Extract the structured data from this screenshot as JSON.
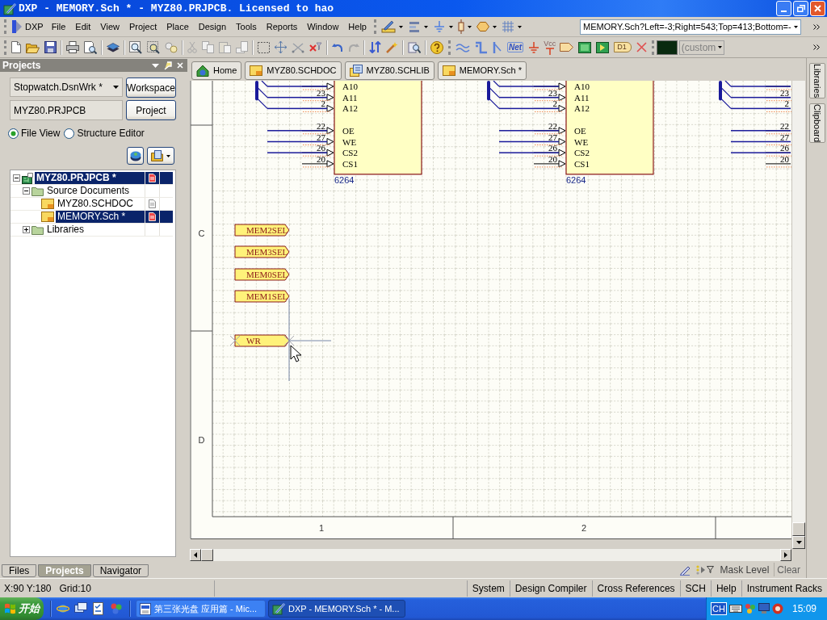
{
  "window": {
    "title": "DXP - MEMORY.Sch * - MYZ80.PRJPCB. Licensed to hao"
  },
  "app_menu": "DXP",
  "menu": [
    "File",
    "Edit",
    "View",
    "Project",
    "Place",
    "Design",
    "Tools",
    "Reports",
    "Window",
    "Help"
  ],
  "address": {
    "value": "MEMORY.Sch?Left=-3;Right=543;Top=413;Bottom=-"
  },
  "wiring_toolbar": {
    "net_label": "Net",
    "power_port": "Vcc",
    "part": "D1"
  },
  "color_combo": {
    "value": "(custom"
  },
  "projects_panel": {
    "title": "Projects",
    "workspace": "Stopwatch.DsnWrk *",
    "workspace_button": "Workspace",
    "project": "MYZ80.PRJPCB",
    "project_button": "Project",
    "views": [
      {
        "label": "File View",
        "selected": true
      },
      {
        "label": "Structure Editor",
        "selected": false
      }
    ],
    "tree": [
      {
        "kind": "project",
        "label": "MYZ80.PRJPCB *",
        "selected": true,
        "modified": true,
        "expanded": true,
        "children": [
          {
            "kind": "folder",
            "label": "Source Documents",
            "selected": false,
            "expanded": true,
            "children": [
              {
                "kind": "document",
                "label": "MYZ80.SCHDOC",
                "selected": false,
                "modified": false
              },
              {
                "kind": "document",
                "label": "MEMORY.Sch *",
                "selected": true,
                "modified": true
              }
            ]
          },
          {
            "kind": "folder",
            "label": "Libraries",
            "selected": false,
            "expanded": false
          }
        ]
      }
    ]
  },
  "panel_tabs": [
    {
      "label": "Files",
      "selected": false
    },
    {
      "label": "Projects",
      "selected": true
    },
    {
      "label": "Navigator",
      "selected": false
    }
  ],
  "document_tabs": [
    {
      "kind": "home",
      "label": "Home"
    },
    {
      "kind": "schematic",
      "label": "MYZ80.SCHDOC"
    },
    {
      "kind": "library",
      "label": "MYZ80.SCHLIB"
    },
    {
      "kind": "schematic",
      "label": "MEMORY.Sch *"
    }
  ],
  "side_tabs": [
    "Libraries",
    "Clipboard"
  ],
  "schematic": {
    "row_zones": [
      "C",
      "D"
    ],
    "column_zones": [
      "1",
      "2"
    ],
    "parts": [
      {
        "comment": "6264",
        "pin_groups": [
          {
            "bus": true,
            "pins": [
              {
                "name": "A10",
                "wire": true
              },
              {
                "number": "23",
                "name": "A11",
                "wire": true
              },
              {
                "number": "2",
                "name": "A12",
                "wire": true
              }
            ]
          },
          {
            "bus": false,
            "pins": [
              {
                "number": "22",
                "name": "OE",
                "wire": true
              },
              {
                "number": "27",
                "name": "WE",
                "wire": true
              },
              {
                "number": "26",
                "name": "CS2",
                "wire": true
              },
              {
                "number": "20",
                "name": "CS1",
                "wire": false
              }
            ]
          }
        ]
      },
      {
        "comment": "6264",
        "pin_groups": [
          {
            "bus": true,
            "pins": [
              {
                "name": "A10",
                "wire": true
              },
              {
                "number": "23",
                "name": "A11",
                "wire": true
              },
              {
                "number": "2",
                "name": "A12",
                "wire": true
              }
            ]
          },
          {
            "bus": false,
            "pins": [
              {
                "number": "22",
                "name": "OE",
                "wire": true
              },
              {
                "number": "27",
                "name": "WE",
                "wire": true
              },
              {
                "number": "26",
                "name": "CS2",
                "wire": true
              },
              {
                "number": "20",
                "name": "CS1",
                "wire": false
              }
            ]
          }
        ]
      },
      {
        "pin_groups": [
          {
            "bus": true,
            "pins": [
              {
                "wire": true
              },
              {
                "number": "23",
                "wire": true
              },
              {
                "number": "2",
                "wire": true
              }
            ]
          },
          {
            "bus": false,
            "pins": [
              {
                "number": "22",
                "wire": true
              },
              {
                "number": "27",
                "wire": true
              },
              {
                "number": "26",
                "wire": true
              },
              {
                "number": "20",
                "wire": false
              }
            ]
          }
        ]
      }
    ],
    "ports": [
      {
        "name": "MEM2SEL",
        "placing": false
      },
      {
        "name": "MEM3SEL",
        "placing": false
      },
      {
        "name": "MEM0SEL",
        "placing": false
      },
      {
        "name": "MEM1SEL",
        "placing": false
      },
      {
        "name": "WR",
        "placing": true
      }
    ]
  },
  "filter_bar": {
    "mask_level": "Mask Level",
    "clear": "Clear"
  },
  "status_bar": {
    "position": "X:90 Y:180",
    "grid": "Grid:10",
    "panels": [
      "System",
      "Design Compiler",
      "Cross References",
      "SCH",
      "Help",
      "Instrument Racks"
    ]
  },
  "taskbar": {
    "start": "开始",
    "tasks": [
      {
        "kind": "document",
        "label": "第三张光盘 应用篇 - Mic...",
        "selected": false
      },
      {
        "kind": "app",
        "label": "DXP - MEMORY.Sch * - M...",
        "selected": true
      }
    ],
    "language": "CH",
    "clock": "15:09"
  }
}
